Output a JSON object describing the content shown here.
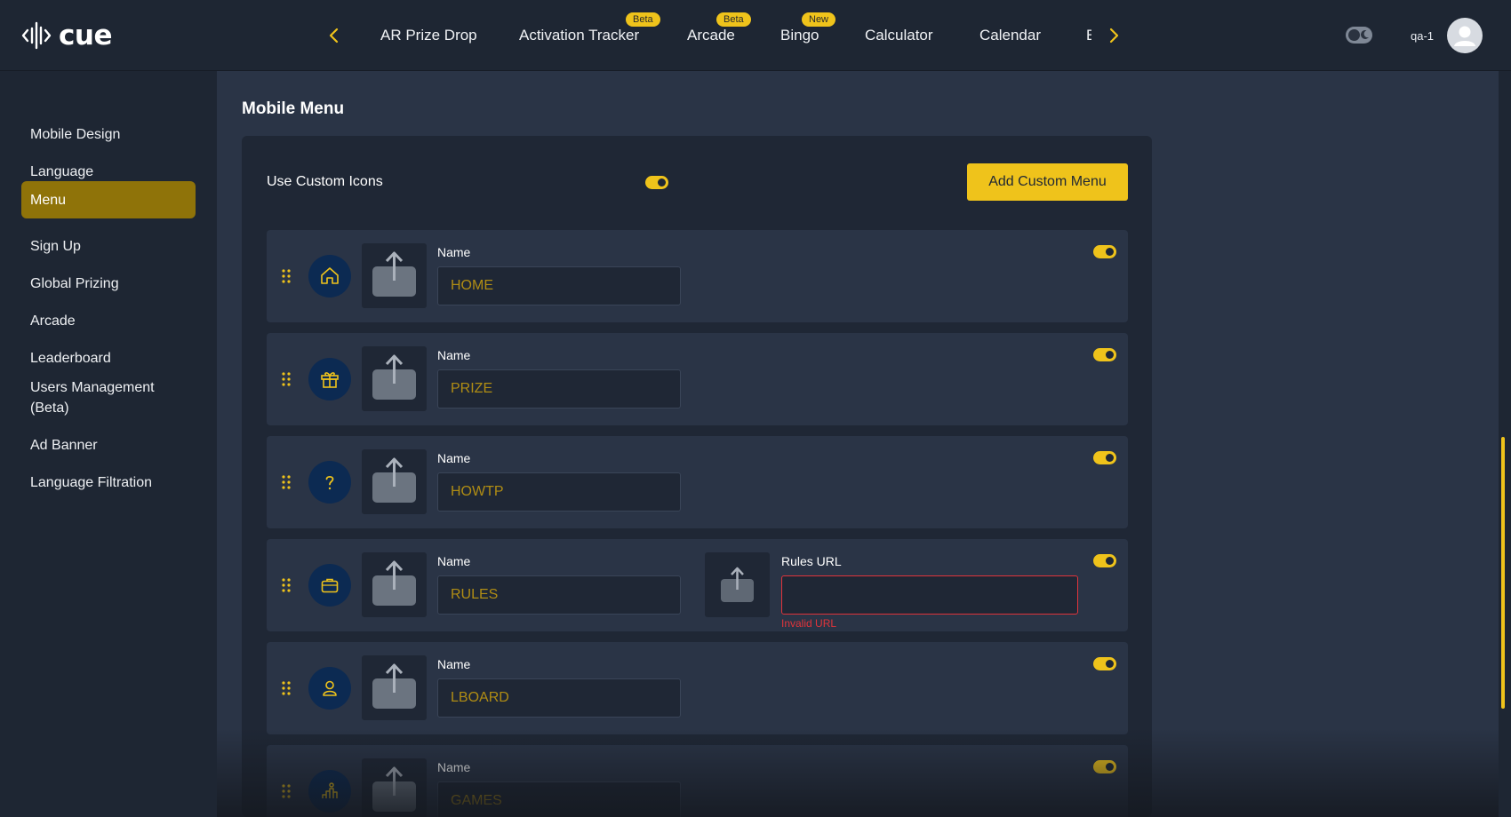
{
  "header": {
    "logo_text": "cue",
    "tabs": [
      {
        "label": "AR Prize Drop",
        "badge": ""
      },
      {
        "label": "Activation Tracker",
        "badge": "Beta"
      },
      {
        "label": "Arcade",
        "badge": "Beta"
      },
      {
        "label": "Bingo",
        "badge": "New"
      },
      {
        "label": "Calculator",
        "badge": ""
      },
      {
        "label": "Calendar",
        "badge": ""
      },
      {
        "label": "E",
        "badge": ""
      }
    ],
    "user_name": "qa-1"
  },
  "sidebar": {
    "items": [
      {
        "label": "Mobile Design"
      },
      {
        "label": "Language"
      },
      {
        "label": "Menu"
      },
      {
        "label": "Sign Up"
      },
      {
        "label": "Global Prizing"
      },
      {
        "label": "Arcade"
      },
      {
        "label": "Leaderboard"
      },
      {
        "label": "Users Management (Beta)"
      },
      {
        "label": "Ad Banner"
      },
      {
        "label": "Language Filtration"
      }
    ],
    "active_index": 2
  },
  "main": {
    "title": "Mobile Menu",
    "use_custom_icons_label": "Use Custom Icons",
    "use_custom_icons_on": true,
    "add_button_label": "Add Custom Menu",
    "menu_items": [
      {
        "icon": "home-icon",
        "name_label": "Name",
        "name_value": "HOME",
        "enabled": true
      },
      {
        "icon": "gift-icon",
        "name_label": "Name",
        "name_value": "PRIZE",
        "enabled": true
      },
      {
        "icon": "question-icon",
        "name_label": "Name",
        "name_value": "HOWTP",
        "enabled": true
      },
      {
        "icon": "briefcase-icon",
        "name_label": "Name",
        "name_value": "RULES",
        "enabled": true,
        "rules_url_label": "Rules URL",
        "rules_url_value": "",
        "rules_url_error": "Invalid URL"
      },
      {
        "icon": "user-icon",
        "name_label": "Name",
        "name_value": "LBOARD",
        "enabled": true
      },
      {
        "icon": "podium-icon",
        "name_label": "Name",
        "name_value": "GAMES",
        "enabled": true
      }
    ]
  },
  "colors": {
    "accent": "#efc31b",
    "active_sidebar": "#8f7309",
    "background": "#2a3446",
    "panel": "#1f2735",
    "icon_circle": "#0c2a52",
    "error": "#e0343b",
    "input_text": "#b08d14"
  }
}
